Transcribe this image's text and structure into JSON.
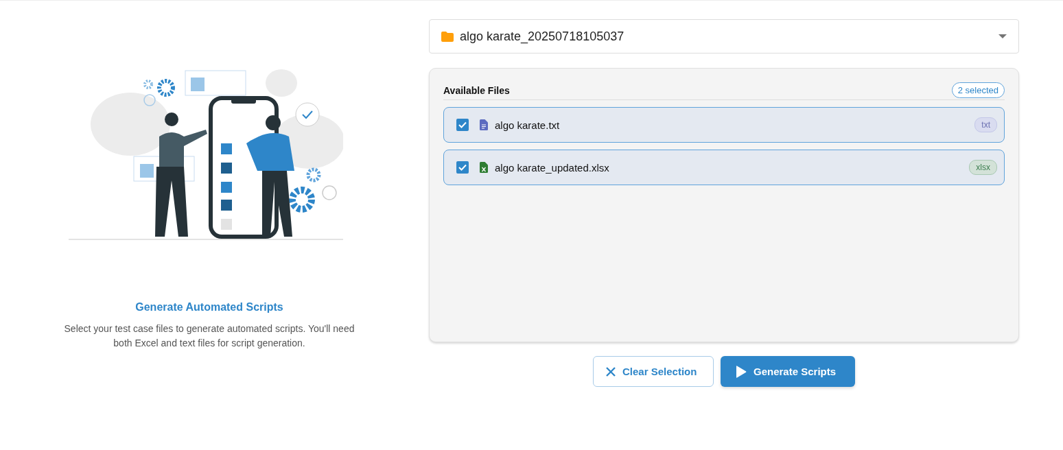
{
  "intro": {
    "title": "Generate Automated Scripts",
    "description": "Select your test case files to generate automated scripts. You'll need both Excel and text files for script generation."
  },
  "folder_select": {
    "value": "algo karate_20250718105037"
  },
  "files_panel": {
    "title": "Available Files",
    "selected_count": "2 selected",
    "files": [
      {
        "name": "algo karate.txt",
        "kind": "text",
        "extension": "txt",
        "checked": true
      },
      {
        "name": "algo karate_updated.xlsx",
        "kind": "excel",
        "extension": "xlsx",
        "checked": true
      }
    ]
  },
  "buttons": [
    {
      "label": "Clear Selection",
      "kind": "clear"
    },
    {
      "label": "Generate Scripts",
      "kind": "generate"
    }
  ]
}
